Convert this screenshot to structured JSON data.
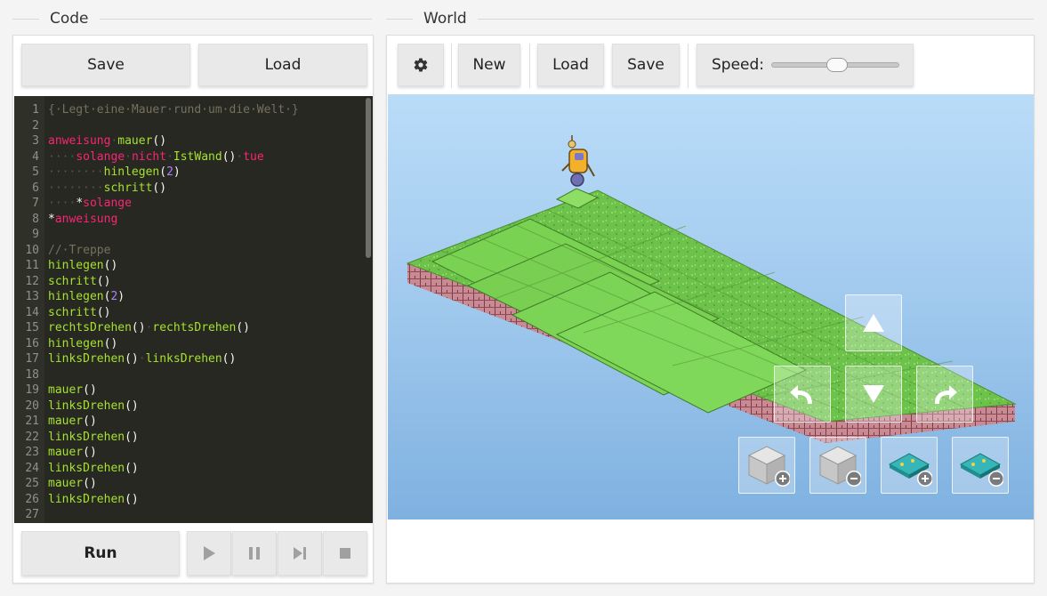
{
  "code_section": {
    "title": "Code",
    "save_label": "Save",
    "load_label": "Load",
    "run_label": "Run",
    "lines": [
      {
        "n": "1",
        "parts": [
          {
            "c": "c-cm",
            "t": "{·Legt·eine·Mauer·rund·um·die·Welt·}"
          }
        ]
      },
      {
        "n": "2",
        "parts": []
      },
      {
        "n": "3",
        "parts": [
          {
            "c": "c-kw",
            "t": "anweisung"
          },
          {
            "c": "c-ws",
            "t": "·"
          },
          {
            "c": "c-fn",
            "t": "mauer"
          },
          {
            "c": "c-pl",
            "t": "()"
          }
        ]
      },
      {
        "n": "4",
        "parts": [
          {
            "c": "c-ws",
            "t": "····"
          },
          {
            "c": "c-kw",
            "t": "solange"
          },
          {
            "c": "c-ws",
            "t": "·"
          },
          {
            "c": "c-kw",
            "t": "nicht"
          },
          {
            "c": "c-ws",
            "t": "·"
          },
          {
            "c": "c-fn",
            "t": "IstWand"
          },
          {
            "c": "c-pl",
            "t": "()"
          },
          {
            "c": "c-ws",
            "t": "·"
          },
          {
            "c": "c-kw",
            "t": "tue"
          }
        ]
      },
      {
        "n": "5",
        "parts": [
          {
            "c": "c-ws",
            "t": "········"
          },
          {
            "c": "c-fn",
            "t": "hinlegen"
          },
          {
            "c": "c-pl",
            "t": "("
          },
          {
            "c": "c-num",
            "t": "2"
          },
          {
            "c": "c-pl",
            "t": ")"
          }
        ]
      },
      {
        "n": "6",
        "parts": [
          {
            "c": "c-ws",
            "t": "········"
          },
          {
            "c": "c-fn",
            "t": "schritt"
          },
          {
            "c": "c-pl",
            "t": "()"
          }
        ]
      },
      {
        "n": "7",
        "parts": [
          {
            "c": "c-ws",
            "t": "····"
          },
          {
            "c": "c-pl",
            "t": "*"
          },
          {
            "c": "c-kw",
            "t": "solange"
          }
        ]
      },
      {
        "n": "8",
        "parts": [
          {
            "c": "c-pl",
            "t": "*"
          },
          {
            "c": "c-kw",
            "t": "anweisung"
          }
        ]
      },
      {
        "n": "9",
        "parts": []
      },
      {
        "n": "10",
        "parts": [
          {
            "c": "c-cm",
            "t": "//·Treppe"
          }
        ]
      },
      {
        "n": "11",
        "parts": [
          {
            "c": "c-fn",
            "t": "hinlegen"
          },
          {
            "c": "c-pl",
            "t": "()"
          }
        ]
      },
      {
        "n": "12",
        "parts": [
          {
            "c": "c-fn",
            "t": "schritt"
          },
          {
            "c": "c-pl",
            "t": "()"
          }
        ]
      },
      {
        "n": "13",
        "parts": [
          {
            "c": "c-fn",
            "t": "hinlegen"
          },
          {
            "c": "c-pl",
            "t": "("
          },
          {
            "c": "c-num",
            "t": "2"
          },
          {
            "c": "c-pl",
            "t": ")"
          }
        ]
      },
      {
        "n": "14",
        "parts": [
          {
            "c": "c-fn",
            "t": "schritt"
          },
          {
            "c": "c-pl",
            "t": "()"
          }
        ]
      },
      {
        "n": "15",
        "parts": [
          {
            "c": "c-fn",
            "t": "rechtsDrehen"
          },
          {
            "c": "c-pl",
            "t": "()"
          },
          {
            "c": "c-ws",
            "t": "·"
          },
          {
            "c": "c-fn",
            "t": "rechtsDrehen"
          },
          {
            "c": "c-pl",
            "t": "()"
          }
        ]
      },
      {
        "n": "16",
        "parts": [
          {
            "c": "c-fn",
            "t": "hinlegen"
          },
          {
            "c": "c-pl",
            "t": "()"
          }
        ]
      },
      {
        "n": "17",
        "parts": [
          {
            "c": "c-fn",
            "t": "linksDrehen"
          },
          {
            "c": "c-pl",
            "t": "()"
          },
          {
            "c": "c-ws",
            "t": "·"
          },
          {
            "c": "c-fn",
            "t": "linksDrehen"
          },
          {
            "c": "c-pl",
            "t": "()"
          }
        ]
      },
      {
        "n": "18",
        "parts": []
      },
      {
        "n": "19",
        "parts": [
          {
            "c": "c-fn",
            "t": "mauer"
          },
          {
            "c": "c-pl",
            "t": "()"
          }
        ]
      },
      {
        "n": "20",
        "parts": [
          {
            "c": "c-fn",
            "t": "linksDrehen"
          },
          {
            "c": "c-pl",
            "t": "()"
          }
        ]
      },
      {
        "n": "21",
        "parts": [
          {
            "c": "c-fn",
            "t": "mauer"
          },
          {
            "c": "c-pl",
            "t": "()"
          }
        ]
      },
      {
        "n": "22",
        "parts": [
          {
            "c": "c-fn",
            "t": "linksDrehen"
          },
          {
            "c": "c-pl",
            "t": "()"
          }
        ]
      },
      {
        "n": "23",
        "parts": [
          {
            "c": "c-fn",
            "t": "mauer"
          },
          {
            "c": "c-pl",
            "t": "()"
          }
        ]
      },
      {
        "n": "24",
        "parts": [
          {
            "c": "c-fn",
            "t": "linksDrehen"
          },
          {
            "c": "c-pl",
            "t": "()"
          }
        ]
      },
      {
        "n": "25",
        "parts": [
          {
            "c": "c-fn",
            "t": "mauer"
          },
          {
            "c": "c-pl",
            "t": "()"
          }
        ]
      },
      {
        "n": "26",
        "parts": [
          {
            "c": "c-fn",
            "t": "linksDrehen"
          },
          {
            "c": "c-pl",
            "t": "()"
          }
        ]
      },
      {
        "n": "27",
        "parts": []
      }
    ],
    "playback_icons": [
      "play-icon",
      "pause-icon",
      "step-icon",
      "stop-icon"
    ]
  },
  "world_section": {
    "title": "World",
    "settings_icon": "gear-icon",
    "new_label": "New",
    "load_label": "Load",
    "save_label": "Save",
    "speed_label": "Speed:",
    "speed_value": 0.52,
    "overlay_icons": [
      "arrow-up-icon",
      "turn-left-icon",
      "arrow-down-icon",
      "turn-right-icon",
      "add-brick-icon",
      "remove-brick-icon",
      "add-marker-icon",
      "remove-marker-icon"
    ]
  },
  "colors": {
    "editor_bg": "#272822",
    "keyword": "#f92672",
    "function": "#a6e22e",
    "number": "#ae81ff",
    "comment": "#75715e",
    "grass": "#6cc24a",
    "brick": "#c98a94",
    "sky_top": "#b9dcf8",
    "sky_bottom": "#7fb1e0"
  }
}
